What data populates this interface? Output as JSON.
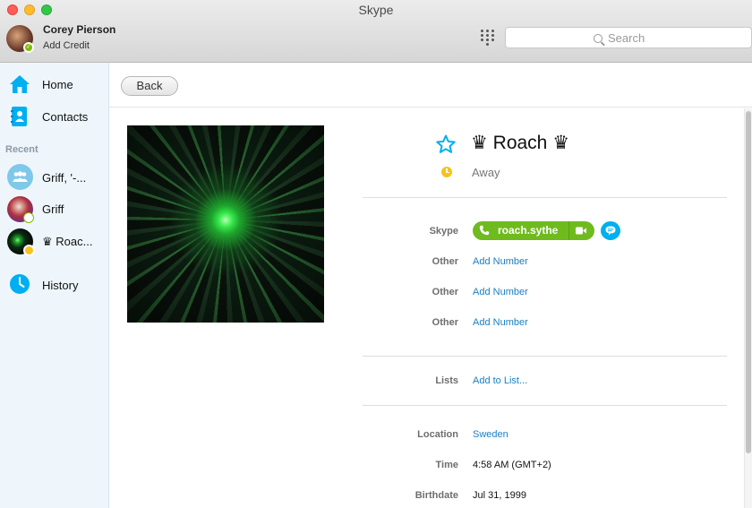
{
  "window": {
    "title": "Skype"
  },
  "profile": {
    "name": "Corey Pierson",
    "credit_link": "Add Credit",
    "status_color": "#7fbb00"
  },
  "search": {
    "placeholder": "Search"
  },
  "sidebar": {
    "home_label": "Home",
    "contacts_label": "Contacts",
    "recent_label": "Recent",
    "recent": [
      {
        "name": "Griff, '-...",
        "status": "group"
      },
      {
        "name": "Griff",
        "status": "offline"
      },
      {
        "name": "♛ Roac...",
        "status": "away"
      }
    ],
    "history_label": "History"
  },
  "toolbar": {
    "back_label": "Back"
  },
  "contact": {
    "display_name": "♛ Roach ♛",
    "status": "Away",
    "skype_label": "Skype",
    "skype_name": "roach.sythe",
    "phones": [
      {
        "label": "Other",
        "action": "Add Number"
      },
      {
        "label": "Other",
        "action": "Add Number"
      },
      {
        "label": "Other",
        "action": "Add Number"
      }
    ],
    "lists_label": "Lists",
    "lists_action": "Add to List...",
    "location_label": "Location",
    "location": "Sweden",
    "time_label": "Time",
    "time": "4:58 AM (GMT+2)",
    "birthdate_label": "Birthdate",
    "birthdate": "Jul 31, 1999"
  },
  "colors": {
    "accent": "#00aff0",
    "online_green": "#6fbb1e",
    "away_yellow": "#f8c21c",
    "link_blue": "#1a7fc0",
    "sidebar_bg": "#eef6fc"
  }
}
